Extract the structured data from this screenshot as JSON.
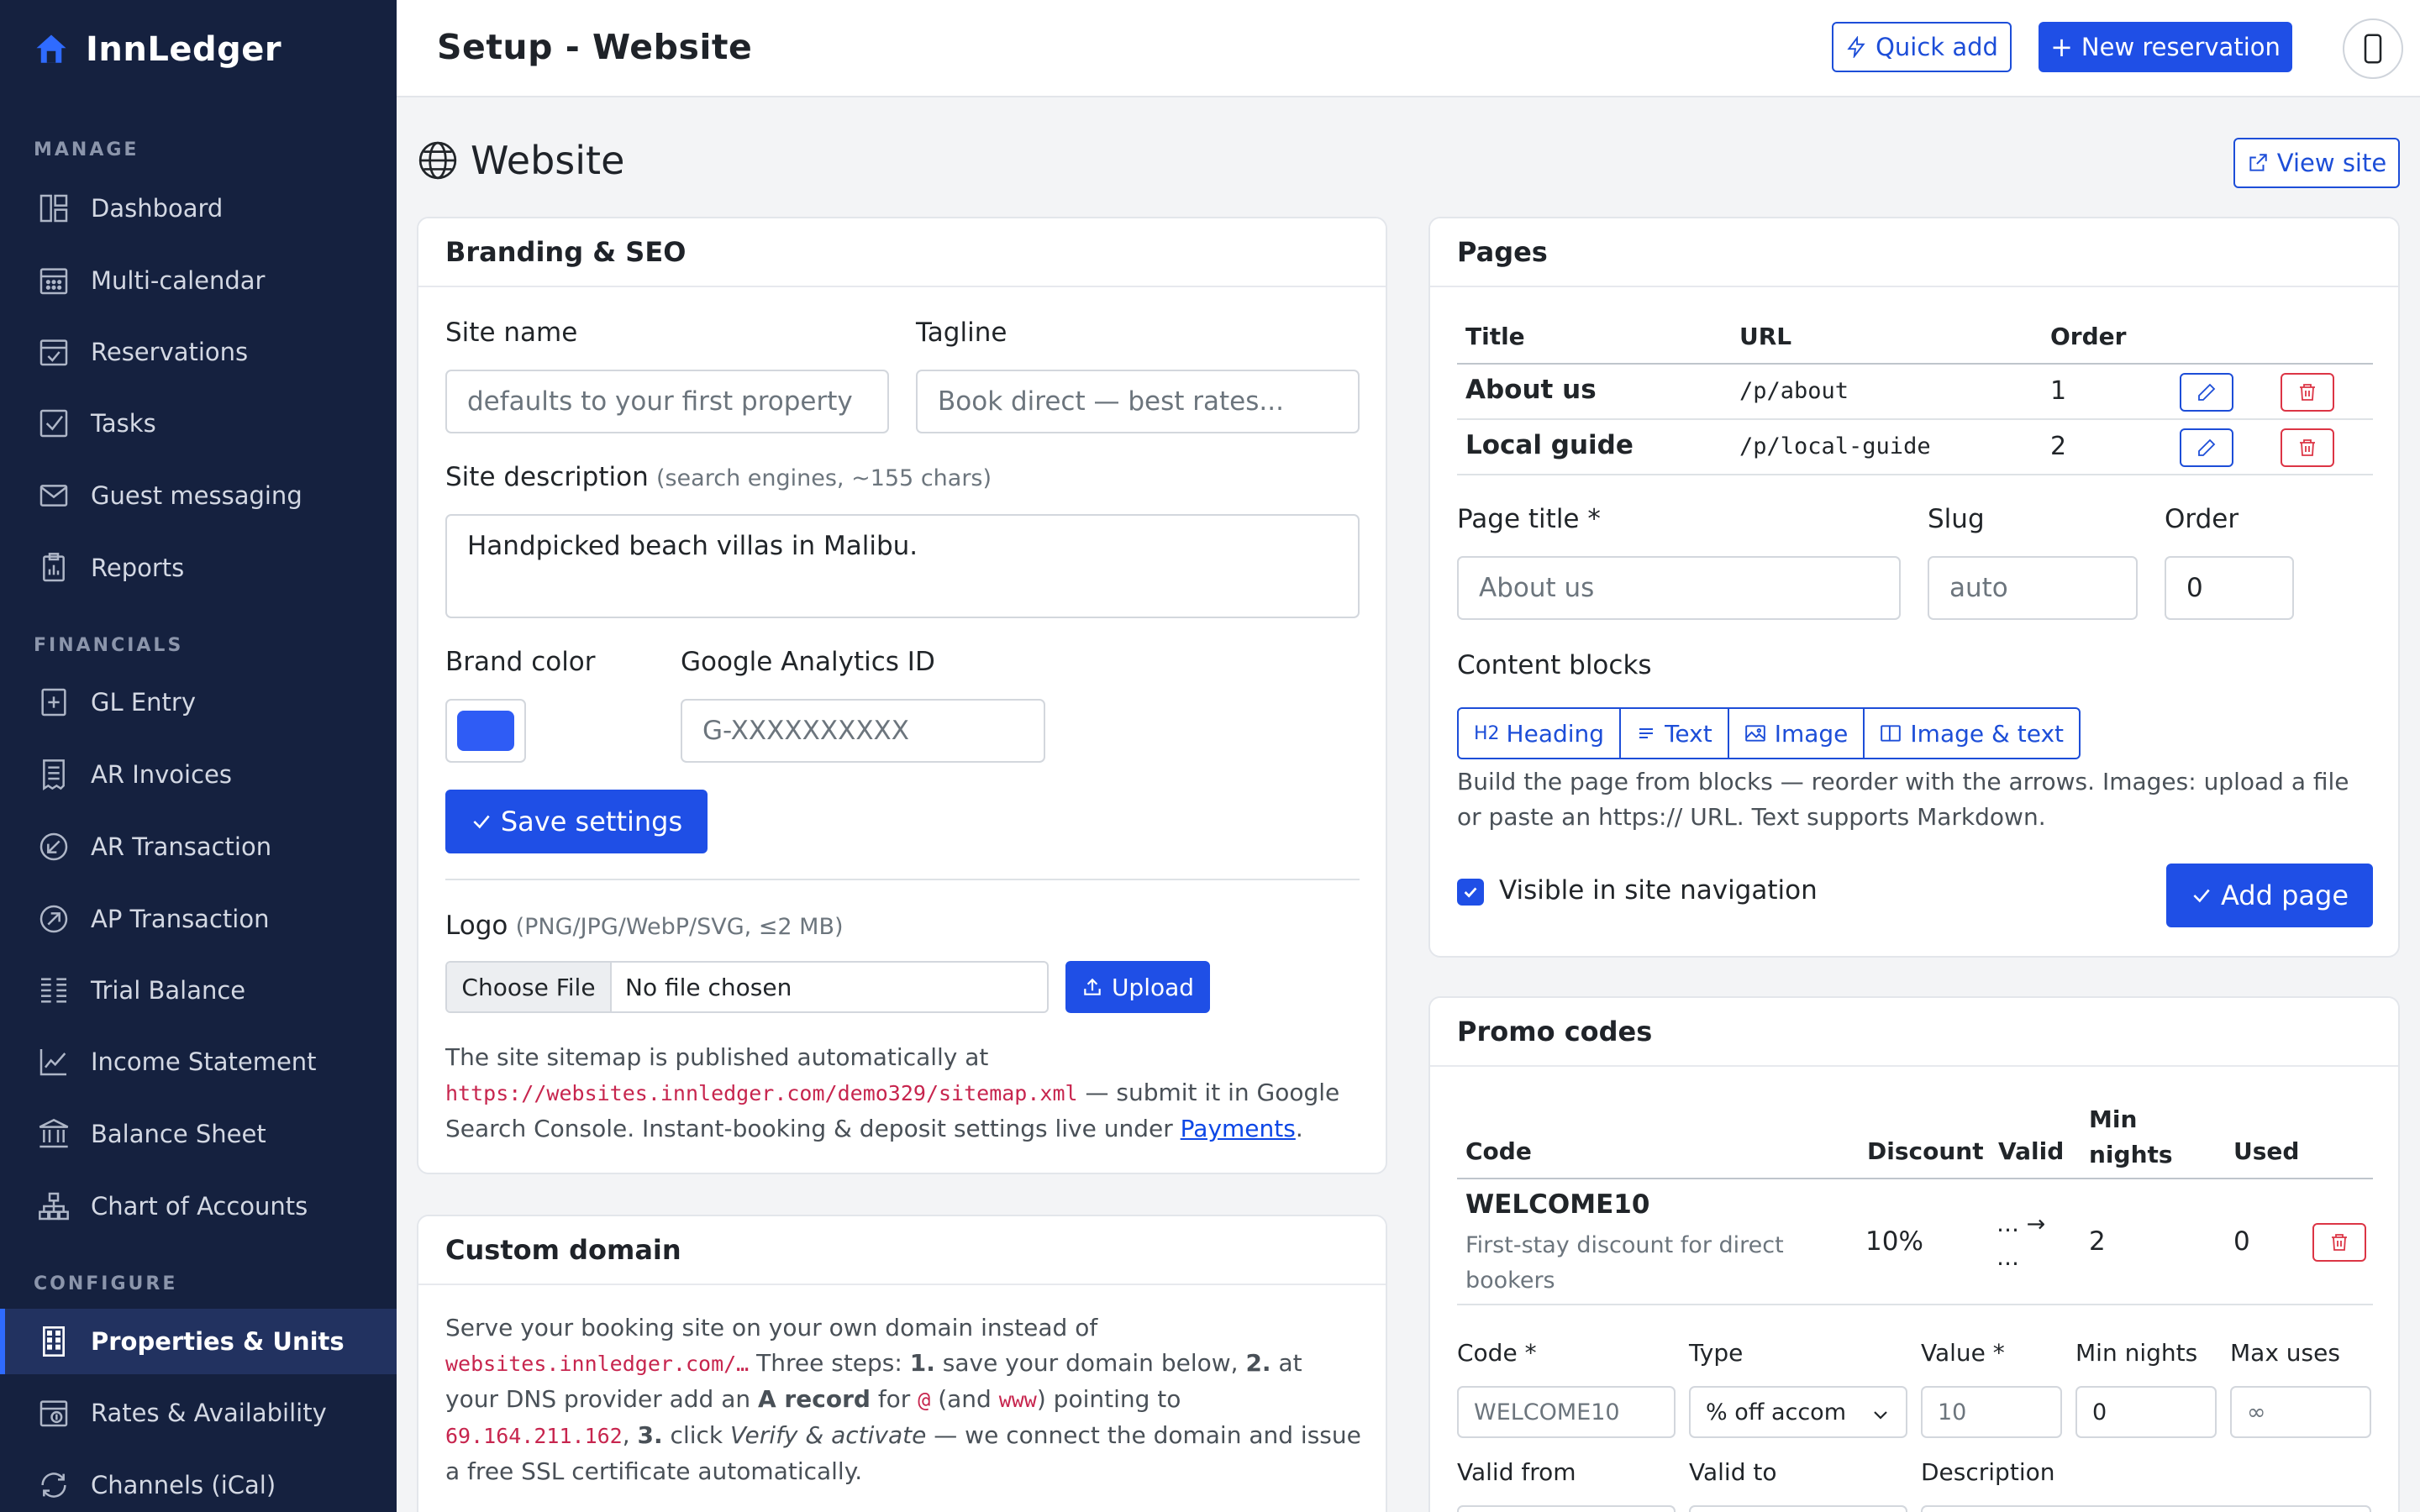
{
  "app": {
    "name": "InnLedger",
    "page_title": "Setup - Website"
  },
  "colors": {
    "sidebar_bg": "#15213f",
    "accent": "#1f4fe6",
    "danger": "#dc3545",
    "brand_color_value": "#2f5cf5"
  },
  "sidebar": {
    "manage_title": "MANAGE",
    "financials_title": "FINANCIALS",
    "configure_title": "CONFIGURE",
    "manage": [
      {
        "label": "Dashboard",
        "icon": "dashboard-icon"
      },
      {
        "label": "Multi-calendar",
        "icon": "calendar-grid-icon"
      },
      {
        "label": "Reservations",
        "icon": "calendar-check-icon"
      },
      {
        "label": "Tasks",
        "icon": "checkbox-icon"
      },
      {
        "label": "Guest messaging",
        "icon": "envelope-icon"
      },
      {
        "label": "Reports",
        "icon": "clipboard-chart-icon"
      }
    ],
    "financials": [
      {
        "label": "GL Entry",
        "icon": "journal-plus-icon"
      },
      {
        "label": "AR Invoices",
        "icon": "receipt-icon"
      },
      {
        "label": "AR Transaction",
        "icon": "arrow-down-left-circle-icon"
      },
      {
        "label": "AP Transaction",
        "icon": "arrow-up-right-circle-icon"
      },
      {
        "label": "Trial Balance",
        "icon": "list-columns-icon"
      },
      {
        "label": "Income Statement",
        "icon": "graph-up-icon"
      },
      {
        "label": "Balance Sheet",
        "icon": "bank-icon"
      },
      {
        "label": "Chart of Accounts",
        "icon": "diagram-icon"
      }
    ],
    "configure": [
      {
        "label": "Properties & Units",
        "icon": "building-icon",
        "active": true
      },
      {
        "label": "Rates & Availability",
        "icon": "calendar-dollar-icon"
      },
      {
        "label": "Channels (iCal)",
        "icon": "sync-icon"
      }
    ]
  },
  "header": {
    "quick_add": "Quick add",
    "new_reservation": "New reservation"
  },
  "website": {
    "title": "Website",
    "view_site": "View site"
  },
  "branding": {
    "title": "Branding & SEO",
    "site_name_label": "Site name",
    "site_name_placeholder": "defaults to your first property",
    "tagline_label": "Tagline",
    "tagline_placeholder": "Book direct — best rates...",
    "description_label": "Site description",
    "description_hint": "(search engines, ~155 chars)",
    "description_value": "Handpicked beach villas in Malibu.",
    "brand_color_label": "Brand color",
    "ga_label": "Google Analytics ID",
    "ga_placeholder": "G-XXXXXXXXXX",
    "save_button": "Save settings",
    "logo_label": "Logo",
    "logo_hint": "(PNG/JPG/WebP/SVG, ≤2 MB)",
    "choose_file": "Choose File",
    "no_file": "No file chosen",
    "upload": "Upload",
    "sitemap_text_1": "The site sitemap is published automatically at",
    "sitemap_url": "https://websites.innledger.com/demo329/sitemap.xml",
    "sitemap_text_2": " — submit it in Google",
    "sitemap_text_3": "Search Console. Instant-booking & deposit settings live under ",
    "payments_link": "Payments",
    "sitemap_text_4": "."
  },
  "custom_domain": {
    "title": "Custom domain",
    "line1": "Serve your booking site on your own domain instead of",
    "domain_code": "websites.innledger.com/…",
    "line2a": " Three steps: ",
    "step1_num": "1.",
    "line2b": " save your domain below, ",
    "step2_num": "2.",
    "line2c": " at",
    "line3a": "your DNS provider add an ",
    "a_record": "A record",
    "line3b": " for ",
    "at_code": "@",
    "line3c": " (and ",
    "www_code": "www",
    "line3d": ") pointing to",
    "ip_code": "69.164.211.162",
    "line4a": ", ",
    "step3_num": "3.",
    "line4b": " click ",
    "verify_text": "Verify & activate",
    "line4c": " — we connect the domain and issue",
    "line5": "a free SSL certificate automatically."
  },
  "pages": {
    "title": "Pages",
    "col_title": "Title",
    "col_url": "URL",
    "col_order": "Order",
    "rows": [
      {
        "title": "About us",
        "url": "/p/about",
        "order": "1"
      },
      {
        "title": "Local guide",
        "url": "/p/local-guide",
        "order": "2"
      }
    ],
    "page_title_label": "Page title *",
    "page_title_placeholder": "About us",
    "slug_label": "Slug",
    "slug_placeholder": "auto",
    "order_label": "Order",
    "order_value": "0",
    "content_blocks_label": "Content blocks",
    "block_heading_prefix": "H2",
    "block_heading": "Heading",
    "block_text": "Text",
    "block_image": "Image",
    "block_image_text": "Image & text",
    "help_line1": "Build the page from blocks — reorder with the arrows. Images: upload a file",
    "help_line2": "or paste an https:// URL. Text supports Markdown.",
    "visible_label": "Visible in site navigation",
    "add_page": "Add page"
  },
  "promo": {
    "title": "Promo codes",
    "col_code": "Code",
    "col_discount": "Discount",
    "col_valid": "Valid",
    "col_min_1": "Min",
    "col_min_2": "nights",
    "col_used": "Used",
    "row": {
      "code": "WELCOME10",
      "desc_1": "First-stay discount for direct",
      "desc_2": "bookers",
      "discount": "10%",
      "valid_1": "… →",
      "valid_2": "…",
      "min": "2",
      "used": "0"
    },
    "code_label": "Code *",
    "code_placeholder": "WELCOME10",
    "type_label": "Type",
    "type_value": "% off accom",
    "value_label": "Value *",
    "value_placeholder": "10",
    "min_label": "Min nights",
    "min_value": "0",
    "max_label": "Max uses",
    "max_placeholder": "∞",
    "valid_from_label": "Valid from",
    "valid_to_label": "Valid to",
    "description_label": "Description"
  }
}
